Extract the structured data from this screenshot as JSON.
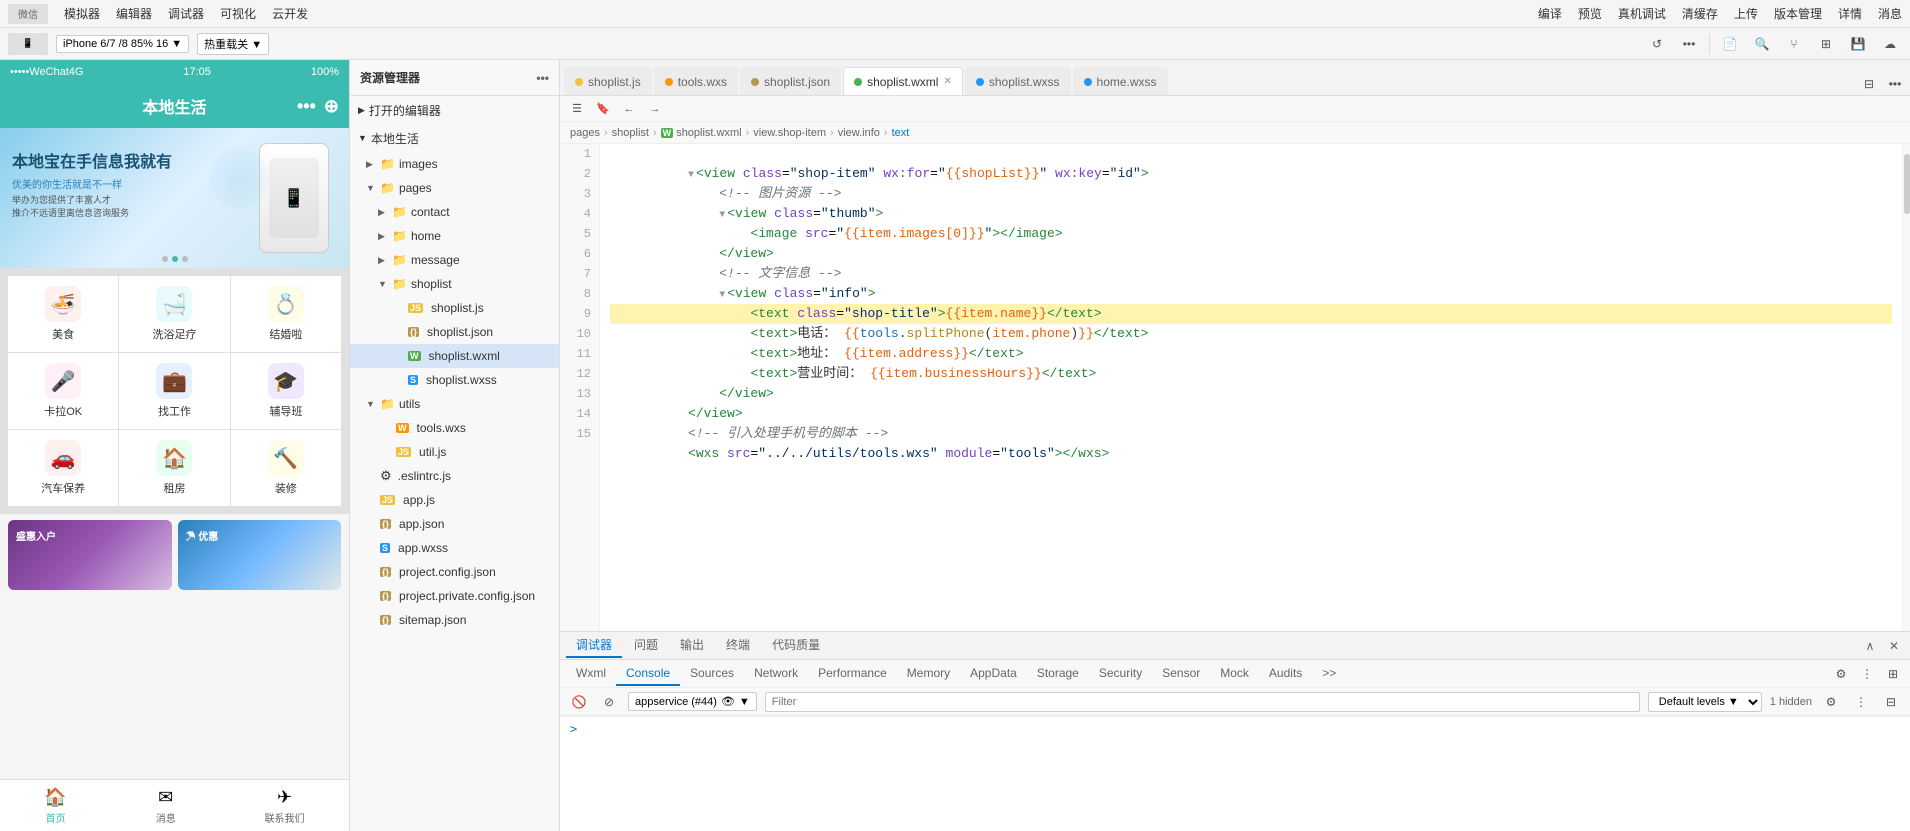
{
  "topbar": {
    "menus": [
      "模拟器",
      "编辑器",
      "调试器",
      "可视化",
      "云开发"
    ],
    "right_menus": [
      "编译",
      "预览",
      "真机调试",
      "清缓存",
      "上传",
      "版本管理",
      "详情",
      "消息"
    ]
  },
  "device_toolbar": {
    "device": "iPhone 6/7 /8 85% 16 ▼",
    "hotreload": "热重载关 ▼"
  },
  "file_explorer": {
    "title": "资源管理器",
    "sections": [
      {
        "label": "打开的编辑器",
        "expanded": true
      },
      {
        "label": "本地生活",
        "expanded": true,
        "children": [
          {
            "type": "folder",
            "name": "images",
            "expanded": false,
            "indent": 1
          },
          {
            "type": "folder",
            "name": "pages",
            "expanded": true,
            "indent": 1,
            "children": [
              {
                "type": "folder",
                "name": "contact",
                "expanded": false,
                "indent": 2
              },
              {
                "type": "folder",
                "name": "home",
                "expanded": false,
                "indent": 2
              },
              {
                "type": "folder",
                "name": "message",
                "expanded": false,
                "indent": 2
              },
              {
                "type": "folder",
                "name": "shoplist",
                "expanded": true,
                "indent": 2,
                "children": [
                  {
                    "type": "js",
                    "name": "shoplist.js",
                    "indent": 3
                  },
                  {
                    "type": "json",
                    "name": "shoplist.json",
                    "indent": 3
                  },
                  {
                    "type": "wxml",
                    "name": "shoplist.wxml",
                    "indent": 3,
                    "selected": true
                  },
                  {
                    "type": "wxss",
                    "name": "shoplist.wxss",
                    "indent": 3
                  }
                ]
              }
            ]
          },
          {
            "type": "folder",
            "name": "utils",
            "expanded": true,
            "indent": 1,
            "children": [
              {
                "type": "wxs",
                "name": "tools.wxs",
                "indent": 2
              },
              {
                "type": "js",
                "name": "util.js",
                "indent": 2
              }
            ]
          },
          {
            "type": "eslint",
            "name": ".eslintrc.js",
            "indent": 1
          },
          {
            "type": "js",
            "name": "app.js",
            "indent": 1
          },
          {
            "type": "json",
            "name": "app.json",
            "indent": 1
          },
          {
            "type": "wxss",
            "name": "app.wxss",
            "indent": 1
          },
          {
            "type": "json",
            "name": "project.config.json",
            "indent": 1
          },
          {
            "type": "json",
            "name": "project.private.config.json",
            "indent": 1
          },
          {
            "type": "json",
            "name": "sitemap.json",
            "indent": 1
          }
        ]
      }
    ]
  },
  "editor_tabs": [
    {
      "name": "shoplist.js",
      "type": "js",
      "active": false,
      "closable": false
    },
    {
      "name": "tools.wxs",
      "type": "wxs",
      "active": false,
      "closable": false
    },
    {
      "name": "shoplist.json",
      "type": "json",
      "active": false,
      "closable": false
    },
    {
      "name": "shoplist.wxml",
      "type": "wxml",
      "active": true,
      "closable": true
    },
    {
      "name": "shoplist.wxss",
      "type": "wxss",
      "active": false,
      "closable": false
    },
    {
      "name": "home.wxss",
      "type": "wxss",
      "active": false,
      "closable": false
    }
  ],
  "breadcrumb": {
    "items": [
      "pages",
      "shoplist",
      "shoplist.wxml",
      "view.shop-item",
      "view.info",
      "text"
    ]
  },
  "code_lines": [
    {
      "num": 1,
      "fold": true,
      "content": "<view class=\"shop-item\" wx:for=\"{{shopList}}\" wx:key=\"id\">"
    },
    {
      "num": 2,
      "fold": false,
      "content": "  <!-- 图片资源 -->"
    },
    {
      "num": 3,
      "fold": true,
      "content": "  <view class=\"thumb\">"
    },
    {
      "num": 4,
      "fold": false,
      "content": "    <image src=\"{{item.images[0]}}\"></image>"
    },
    {
      "num": 5,
      "fold": false,
      "content": "  </view>"
    },
    {
      "num": 6,
      "fold": false,
      "content": "  <!-- 文字信息 -->"
    },
    {
      "num": 7,
      "fold": true,
      "content": "  <view class=\"info\">"
    },
    {
      "num": 8,
      "fold": false,
      "content": "    <text class=\"shop-title\">{{item.name}}</text>"
    },
    {
      "num": 9,
      "fold": false,
      "content": "    <text>电话：{{tools.splitPhone(item.phone)}}</text>"
    },
    {
      "num": 10,
      "fold": false,
      "content": "    <text>地址：{{item.address}}</text>"
    },
    {
      "num": 11,
      "fold": false,
      "content": "    <text>营业时间：{{item.businessHours}}</text>"
    },
    {
      "num": 12,
      "fold": false,
      "content": "  </view>"
    },
    {
      "num": 13,
      "fold": false,
      "content": "</view>"
    },
    {
      "num": 14,
      "fold": false,
      "content": "<!-- 引入处理手机号的脚本 -->"
    },
    {
      "num": 15,
      "fold": false,
      "content": "<wxs src=\"../../utils/tools.wxs\" module=\"tools\"></wxs>"
    }
  ],
  "bottom_panel": {
    "tabs": [
      "调试器",
      "问题",
      "输出",
      "终端",
      "代码质量"
    ],
    "active_tab": "调试器",
    "debug_tabs": [
      "Wxml",
      "Console",
      "Sources",
      "Network",
      "Performance",
      "Memory",
      "AppData",
      "Storage",
      "Security",
      "Sensor",
      "Mock",
      "Audits"
    ],
    "active_debug_tab": "Console",
    "service": "appservice (#44)",
    "filter_placeholder": "Filter",
    "level": "Default levels ▼",
    "hidden_count": "1 hidden",
    "console_prompt": ">"
  },
  "phone": {
    "carrier": "•••••WeChat4G",
    "time": "17:05",
    "battery": "100%",
    "title": "本地生活",
    "grid_items": [
      {
        "label": "美食",
        "color": "#ff6b6b"
      },
      {
        "label": "洗浴足疗",
        "color": "#4ecdc4"
      },
      {
        "label": "结婚啦",
        "color": "#ffe66d"
      },
      {
        "label": "卡拉OK",
        "color": "#ff9ff3"
      },
      {
        "label": "找工作",
        "color": "#54a0ff"
      },
      {
        "label": "辅导班",
        "color": "#5f27cd"
      },
      {
        "label": "汽车保养",
        "color": "#ff6b6b"
      },
      {
        "label": "租房",
        "color": "#1dd1a1"
      },
      {
        "label": "装修",
        "color": "#feca57"
      }
    ],
    "bottom_nav": [
      {
        "label": "首页",
        "active": true
      },
      {
        "label": "消息",
        "active": false
      },
      {
        "label": "联系我们",
        "active": false
      }
    ]
  }
}
